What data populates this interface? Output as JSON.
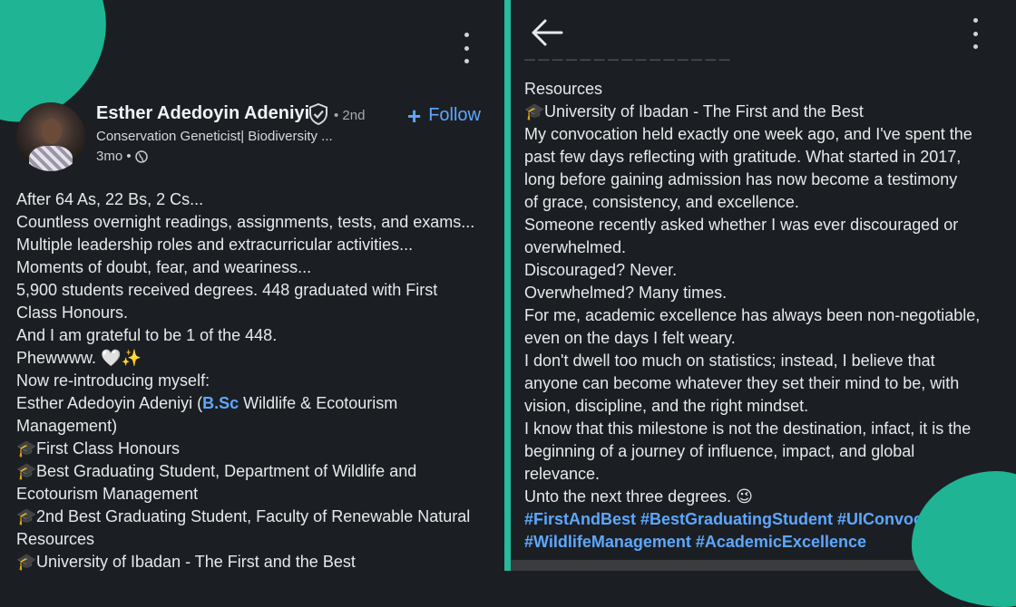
{
  "profile": {
    "name": "Esther Adedoyin Adeniyi",
    "degree": "• 2nd",
    "headline": "Conservation Geneticist| Biodiversity ...",
    "age": "3mo •",
    "follow_label": "Follow",
    "avatar_icon": "profile-photo",
    "verified_icon": "verified-shield-icon"
  },
  "left_post": {
    "lines": [
      "After 64 As, 22 Bs, 2 Cs...",
      "Countless overnight readings, assignments, tests, and exams...",
      "Multiple leadership roles and extracurricular activities...",
      "Moments of doubt, fear, and weariness...",
      "5,900 students received degrees. 448 graduated with First",
      "Class Honours.",
      "And I am grateful to be 1 of the 448.",
      "Phewwww. 🤍✨",
      "Now re-introducing myself:"
    ],
    "name_line_prefix": "Esther Adedoyin Adeniyi (",
    "name_line_link": "B.Sc",
    "name_line_suffix": " Wildlife & Ecotourism",
    "name_line_cont": "Management)",
    "cap_lines": [
      {
        "cap": "🎓",
        "text": "First Class Honours"
      },
      {
        "cap": "🎓",
        "text": "Best Graduating Student, Department of Wildlife and"
      },
      {
        "cap": "",
        "text": "Ecotourism Management"
      },
      {
        "cap": "🎓",
        "text": "2nd Best Graduating Student, Faculty of Renewable Natural"
      },
      {
        "cap": "",
        "text": "Resources"
      },
      {
        "cap": "🎓",
        "text": "University of Ibadan - The First and the Best"
      }
    ]
  },
  "right_post": {
    "faded_line": "— — — — — — — — — — — — — — —",
    "lines_top": [
      "Resources"
    ],
    "cap_line": {
      "cap": "🎓",
      "text": "University of Ibadan - The First and the Best"
    },
    "lines": [
      "My convocation held exactly one week ago, and I've spent the",
      "past few days reflecting with gratitude. What started in 2017,",
      "long before gaining admission has now become a testimony",
      "of grace, consistency, and excellence.",
      "Someone recently asked whether I was ever discouraged or",
      "overwhelmed.",
      "Discouraged? Never.",
      "Overwhelmed? Many times.",
      "For me, academic excellence has always been non-negotiable,",
      "even on the days I felt weary.",
      "I don't dwell too much on statistics; instead, I believe that",
      "anyone can become whatever they set their mind to be, with",
      "vision, discipline, and the right mindset.",
      "I know that this milestone is not the destination, infact, it is the",
      "beginning of a journey of influence, impact, and global",
      "relevance.",
      "Unto the next three degrees. 😉"
    ],
    "hashtags_line1": "#FirstAndBest #BestGraduatingStudent #UIConvocat",
    "hashtags_line2": "#WildlifeManagement #AcademicExcellence"
  },
  "icons": {
    "back": "back-arrow-icon",
    "menu": "more-options-icon",
    "globe": "globe-icon"
  },
  "colors": {
    "background": "#1b1f23",
    "accent": "#27b99b",
    "link": "#5ea7ff"
  }
}
